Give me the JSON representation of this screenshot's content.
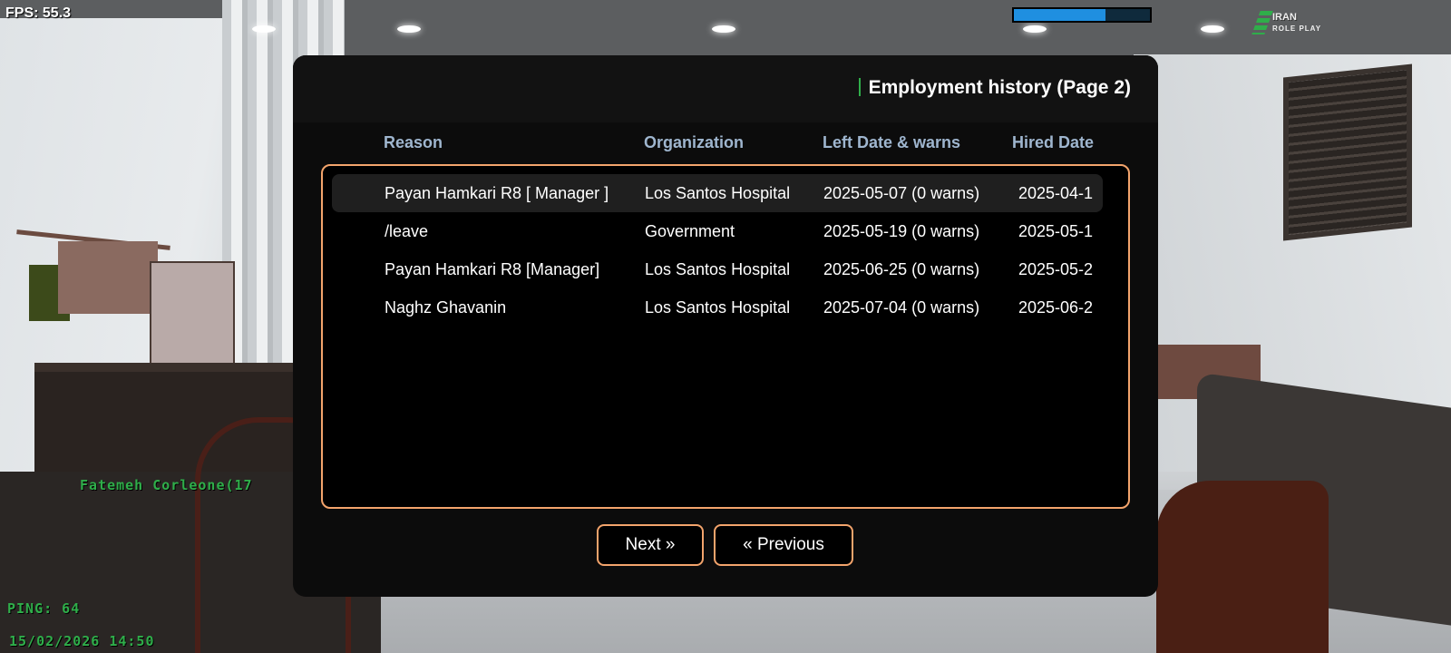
{
  "hud": {
    "fps": "FPS: 55.3",
    "health_fraction": 0.67,
    "server_logo_line1": "IRAN",
    "server_logo_line2": "ROLE PLAY",
    "player_nametag": "Fatemeh Corleone(17",
    "ping": "PING: 64",
    "datetime": "15/02/2026 14:50"
  },
  "dialog": {
    "title": "Employment history (Page 2)",
    "columns": [
      "Reason",
      "Organization",
      "Left Date & warns",
      "Hired Date"
    ],
    "rows": [
      [
        "Payan Hamkari R8 [ Manager ]",
        "Los Santos Hospital",
        "2025-05-07 (0 warns)",
        "2025-04-1"
      ],
      [
        "/leave",
        "Government",
        "2025-05-19 (0 warns)",
        "2025-05-1"
      ],
      [
        "Payan Hamkari R8 [Manager]",
        "Los Santos Hospital",
        "2025-06-25 (0 warns)",
        "2025-05-2"
      ],
      [
        "Naghz Ghavanin",
        "Los Santos Hospital",
        "2025-07-04 (0 warns)",
        "2025-06-2"
      ]
    ],
    "selected_row": 0,
    "buttons": {
      "next": "Next »",
      "previous": "« Previous"
    }
  },
  "colors": {
    "accent_border": "#f3a46c",
    "header_text": "#9fb6cf",
    "title_marker": "#2fae4a",
    "hud_green": "#2fae4a"
  }
}
